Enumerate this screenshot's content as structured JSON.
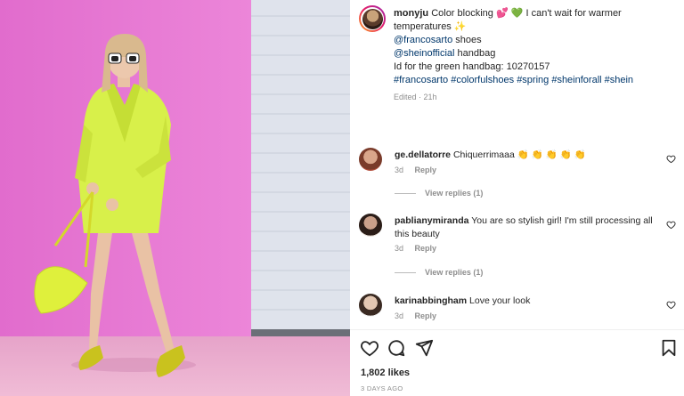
{
  "post": {
    "username": "monyju",
    "caption_text": "Color blocking",
    "caption_emoji_1": "💕",
    "caption_emoji_2": "💚",
    "caption_rest": "I can't wait for warmer temperatures",
    "caption_sparkle": "✨",
    "mention_1": "@francosarto",
    "mention_1_suffix": " shoes",
    "mention_2": "@sheinofficial",
    "mention_2_suffix": " handbag",
    "id_line": "Id for the green handbag: 10270157",
    "hashtags": "#francosarto #colorfulshoes #spring #sheinforall #shein",
    "edited": "Edited · 21h"
  },
  "comments": [
    {
      "username": "ge.dellatorre",
      "text": "Chiquerrimaaa 👏 👏 👏 👏 👏",
      "age": "3d",
      "reply_label": "Reply",
      "view_replies": "View replies (1)"
    },
    {
      "username": "pablianymiranda",
      "text": "You are so stylish girl! I'm still processing all this beauty",
      "age": "3d",
      "reply_label": "Reply",
      "view_replies": "View replies (1)"
    },
    {
      "username": "karinabbingham",
      "text": "Love your look",
      "age": "3d",
      "reply_label": "Reply"
    }
  ],
  "footer": {
    "likes": "1,802 likes",
    "date": "3 DAYS AGO"
  },
  "icons": {
    "like": "heart-icon",
    "comment": "comment-icon",
    "share": "share-icon",
    "save": "bookmark-icon"
  },
  "colors": {
    "wall_pink": "#e46fcf",
    "link_blue": "#00376b",
    "muted_gray": "#8e8e8e"
  }
}
